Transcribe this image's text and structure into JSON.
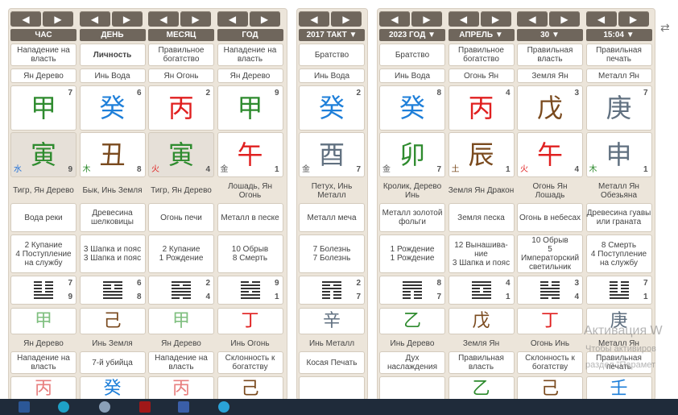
{
  "nav": {
    "prev": "◀",
    "next": "▶"
  },
  "left": {
    "headers": [
      "ЧАС",
      "ДЕНЬ",
      "МЕСЯЦ",
      "ГОД"
    ],
    "cols": [
      {
        "rel": "Нападение на власть",
        "stem_name": "Ян Дерево",
        "stem": "甲",
        "stem_color": "#2e8b2e",
        "stem_num": "7",
        "branch": "寅",
        "branch_color": "#2e8b2e",
        "branch_num": "9",
        "branch_elem": "水",
        "branch_elem_color": "#1e6fd9",
        "branch_bg": "#e6e0d8",
        "animal": "Тигр, Ян Дерево",
        "nayin": "Вода реки",
        "stars": "2 Купание\n4 Поступление на службу",
        "hx_top": "7",
        "hx_bot": "9",
        "hid_char": "甲",
        "hid_color": "#7fbf7f",
        "hid_name": "Ян Дерево",
        "hid_rel": "Нападение на власть",
        "bot_char": "丙",
        "bot_color": "#e87f7f"
      },
      {
        "rel": "Личность",
        "stem_name": "Инь Вода",
        "stem": "癸",
        "stem_color": "#1e7fd9",
        "stem_num": "6",
        "branch": "丑",
        "branch_color": "#7a4a1e",
        "branch_num": "8",
        "branch_elem": "木",
        "branch_elem_color": "#2e8b2e",
        "branch_bg": "#ffffff",
        "animal": "Бык, Инь Земля",
        "nayin": "Древесина шелковицы",
        "stars": "3 Шапка и пояс\n3 Шапка и пояс",
        "hx_top": "6",
        "hx_bot": "8",
        "hid_char": "己",
        "hid_color": "#7a4a1e",
        "hid_name": "Инь Земля",
        "hid_rel": "7-й убийца",
        "bot_char": "癸",
        "bot_color": "#1e7fd9"
      },
      {
        "rel": "Правильное богатство",
        "stem_name": "Ян Огонь",
        "stem": "丙",
        "stem_color": "#e02020",
        "stem_num": "2",
        "branch": "寅",
        "branch_color": "#2e8b2e",
        "branch_num": "4",
        "branch_elem": "火",
        "branch_elem_color": "#e02020",
        "branch_bg": "#e6e0d8",
        "animal": "Тигр, Ян Дерево",
        "nayin": "Огонь печи",
        "stars": "2 Купание\n1 Рождение",
        "hx_top": "2",
        "hx_bot": "4",
        "hid_char": "甲",
        "hid_color": "#7fbf7f",
        "hid_name": "Ян Дерево",
        "hid_rel": "Нападение на власть",
        "bot_char": "丙",
        "bot_color": "#e87f7f"
      },
      {
        "rel": "Нападение на власть",
        "stem_name": "Ян Дерево",
        "stem": "甲",
        "stem_color": "#2e8b2e",
        "stem_num": "9",
        "branch": "午",
        "branch_color": "#e02020",
        "branch_num": "1",
        "branch_elem": "金",
        "branch_elem_color": "#555555",
        "branch_bg": "#ffffff",
        "animal": "Лошадь, Ян Огонь",
        "nayin": "Металл в песке",
        "stars": "10 Обрыв\n8 Смерть",
        "hx_top": "9",
        "hx_bot": "1",
        "hid_char": "丁",
        "hid_color": "#e02020",
        "hid_name": "Инь Огонь",
        "hid_rel": "Склонность к богатству",
        "bot_char": "己",
        "bot_color": "#7a4a1e"
      }
    ]
  },
  "middle": {
    "header": "2017 ТАКТ ▼",
    "col": {
      "rel": "Братство",
      "stem_name": "Инь Вода",
      "stem": "癸",
      "stem_color": "#1e7fd9",
      "stem_num": "2",
      "branch": "酉",
      "branch_color": "#607080",
      "branch_num": "7",
      "branch_elem": "金",
      "branch_elem_color": "#555555",
      "branch_bg": "#ffffff",
      "animal": "Петух, Инь Металл",
      "nayin": "Металл меча",
      "stars": "7 Болезнь\n7 Болезнь",
      "hx_top": "2",
      "hx_bot": "7",
      "hid_char": "辛",
      "hid_color": "#607080",
      "hid_name": "Инь Металл",
      "hid_rel": "Косая Печать",
      "bot_char": "",
      "bot_color": "#333"
    }
  },
  "right": {
    "headers": [
      "2023 ГОД ▼",
      "АПРЕЛЬ ▼",
      "30 ▼",
      "15:04 ▼"
    ],
    "cols": [
      {
        "rel": "Братство",
        "stem_name": "Инь Вода",
        "stem": "癸",
        "stem_color": "#1e7fd9",
        "stem_num": "8",
        "branch": "卯",
        "branch_color": "#2e8b2e",
        "branch_num": "7",
        "branch_elem": "金",
        "branch_elem_color": "#555555",
        "branch_bg": "#ffffff",
        "animal": "Кролик, Дерево Инь",
        "nayin": "Металл золотой фольги",
        "stars": "1 Рождение\n1 Рождение",
        "hx_top": "8",
        "hx_bot": "7",
        "hid_char": "乙",
        "hid_color": "#2e8b2e",
        "hid_name": "Инь Дерево",
        "hid_rel": "Дух наслаждения",
        "bot_char": "",
        "bot_color": "#333"
      },
      {
        "rel": "Правильное богатство",
        "stem_name": "Огонь Ян",
        "stem": "丙",
        "stem_color": "#e02020",
        "stem_num": "4",
        "branch": "辰",
        "branch_color": "#7a4a1e",
        "branch_num": "1",
        "branch_elem": "土",
        "branch_elem_color": "#7a4a1e",
        "branch_bg": "#ffffff",
        "animal": "Земля Ян Дракон",
        "nayin": "Земля песка",
        "stars": "12 Вынашива-ние\n3 Шапка и пояс",
        "hx_top": "4",
        "hx_bot": "1",
        "hid_char": "戊",
        "hid_color": "#7a4a1e",
        "hid_name": "Земля Ян",
        "hid_rel": "Правильная власть",
        "bot_char": "乙",
        "bot_color": "#2e8b2e"
      },
      {
        "rel": "Правильная власть",
        "stem_name": "Земля Ян",
        "stem": "戊",
        "stem_color": "#7a4a1e",
        "stem_num": "3",
        "branch": "午",
        "branch_color": "#e02020",
        "branch_num": "4",
        "branch_elem": "火",
        "branch_elem_color": "#e02020",
        "branch_bg": "#ffffff",
        "animal": "Огонь Ян Лошадь",
        "nayin": "Огонь в небесах",
        "stars": "10 Обрыв\n5 Императорский светильник",
        "hx_top": "3",
        "hx_bot": "4",
        "hid_char": "丁",
        "hid_color": "#e02020",
        "hid_name": "Огонь Инь",
        "hid_rel": "Склонность к богатству",
        "bot_char": "己",
        "bot_color": "#7a4a1e"
      },
      {
        "rel": "Правильная печать",
        "stem_name": "Металл Ян",
        "stem": "庚",
        "stem_color": "#607080",
        "stem_num": "7",
        "branch": "申",
        "branch_color": "#607080",
        "branch_num": "1",
        "branch_elem": "木",
        "branch_elem_color": "#2e8b2e",
        "branch_bg": "#ffffff",
        "animal": "Металл Ян Обезьяна",
        "nayin": "Древесина гуавы или граната",
        "stars": "8 Смерть\n4 Поступление на службу",
        "hx_top": "7",
        "hx_bot": "1",
        "hid_char": "庚",
        "hid_color": "#607080",
        "hid_name": "Металл Ян",
        "hid_rel": "Правильная печать",
        "bot_char": "壬",
        "bot_color": "#1e7fd9"
      }
    ]
  },
  "watermark": {
    "line1": "Активация W",
    "line2": "Чтобы активиров",
    "line3": "раздел \"Парамет"
  }
}
